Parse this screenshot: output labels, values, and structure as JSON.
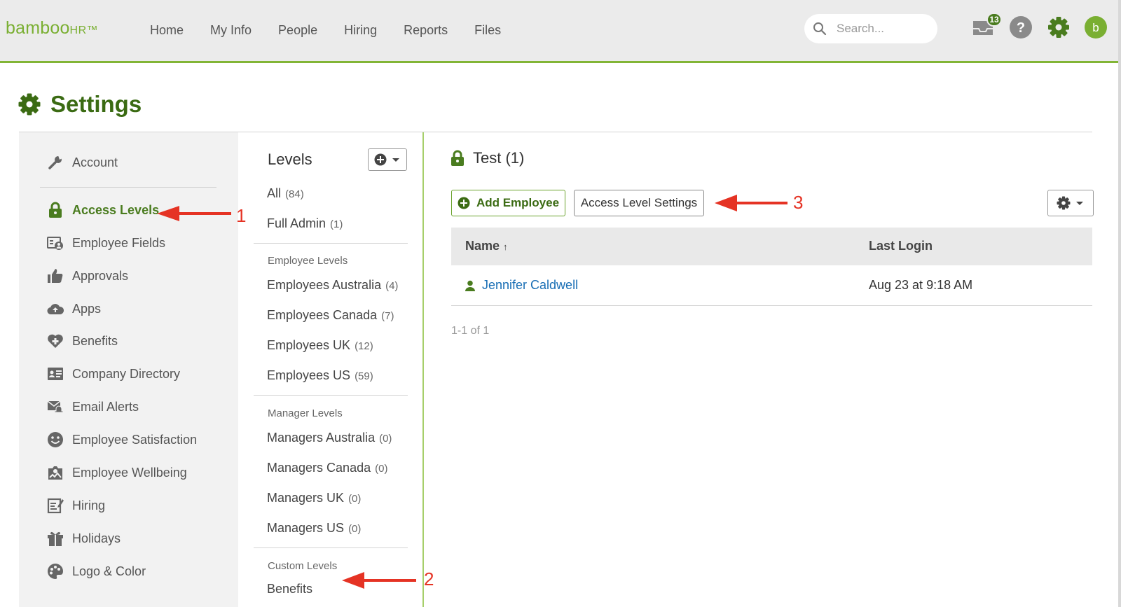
{
  "app": {
    "logo_main": "bamboo",
    "logo_suffix": "HR™"
  },
  "nav": {
    "items": [
      "Home",
      "My Info",
      "People",
      "Hiring",
      "Reports",
      "Files"
    ]
  },
  "search": {
    "placeholder": "Search..."
  },
  "notifications": {
    "count": "13"
  },
  "page": {
    "title": "Settings"
  },
  "sidebar": {
    "items": [
      {
        "label": "Account",
        "icon": "wrench-icon"
      },
      {
        "label": "Access Levels",
        "icon": "lock-icon",
        "active": true
      },
      {
        "label": "Employee Fields",
        "icon": "employee-fields-icon"
      },
      {
        "label": "Approvals",
        "icon": "thumbs-up-icon"
      },
      {
        "label": "Apps",
        "icon": "cloud-upload-icon"
      },
      {
        "label": "Benefits",
        "icon": "heart-plus-icon"
      },
      {
        "label": "Company Directory",
        "icon": "directory-card-icon"
      },
      {
        "label": "Email Alerts",
        "icon": "email-alert-icon"
      },
      {
        "label": "Employee Satisfaction",
        "icon": "smiley-icon"
      },
      {
        "label": "Employee Wellbeing",
        "icon": "wellbeing-icon"
      },
      {
        "label": "Hiring",
        "icon": "clipboard-edit-icon"
      },
      {
        "label": "Holidays",
        "icon": "gift-icon"
      },
      {
        "label": "Logo & Color",
        "icon": "palette-icon"
      }
    ]
  },
  "levels": {
    "heading": "Levels",
    "top": [
      {
        "label": "All",
        "count": "(84)"
      },
      {
        "label": "Full Admin",
        "count": "(1)"
      }
    ],
    "employee_section": "Employee Levels",
    "employee": [
      {
        "label": "Employees Australia",
        "count": "(4)"
      },
      {
        "label": "Employees Canada",
        "count": "(7)"
      },
      {
        "label": "Employees UK",
        "count": "(12)"
      },
      {
        "label": "Employees US",
        "count": "(59)"
      }
    ],
    "manager_section": "Manager Levels",
    "manager": [
      {
        "label": "Managers Australia",
        "count": "(0)"
      },
      {
        "label": "Managers Canada",
        "count": "(0)"
      },
      {
        "label": "Managers UK",
        "count": "(0)"
      },
      {
        "label": "Managers US",
        "count": "(0)"
      }
    ],
    "custom_section": "Custom Levels",
    "custom": [
      {
        "label": "Benefits"
      }
    ]
  },
  "main": {
    "level_title": "Test (1)",
    "add_employee": "Add Employee",
    "access_level_settings": "Access Level Settings",
    "table": {
      "col_name": "Name",
      "sort_indicator": "↑",
      "col_login": "Last Login",
      "rows": [
        {
          "name": "Jennifer Caldwell",
          "last_login": "Aug 23 at 9:18 AM"
        }
      ]
    },
    "pager": "1-1 of 1"
  },
  "annotations": [
    "1",
    "2",
    "3"
  ],
  "colors": {
    "brand_green": "#7aaf32",
    "dark_green": "#3b6b13",
    "link_blue": "#1a6fb5",
    "annotation_red": "#e53324"
  }
}
